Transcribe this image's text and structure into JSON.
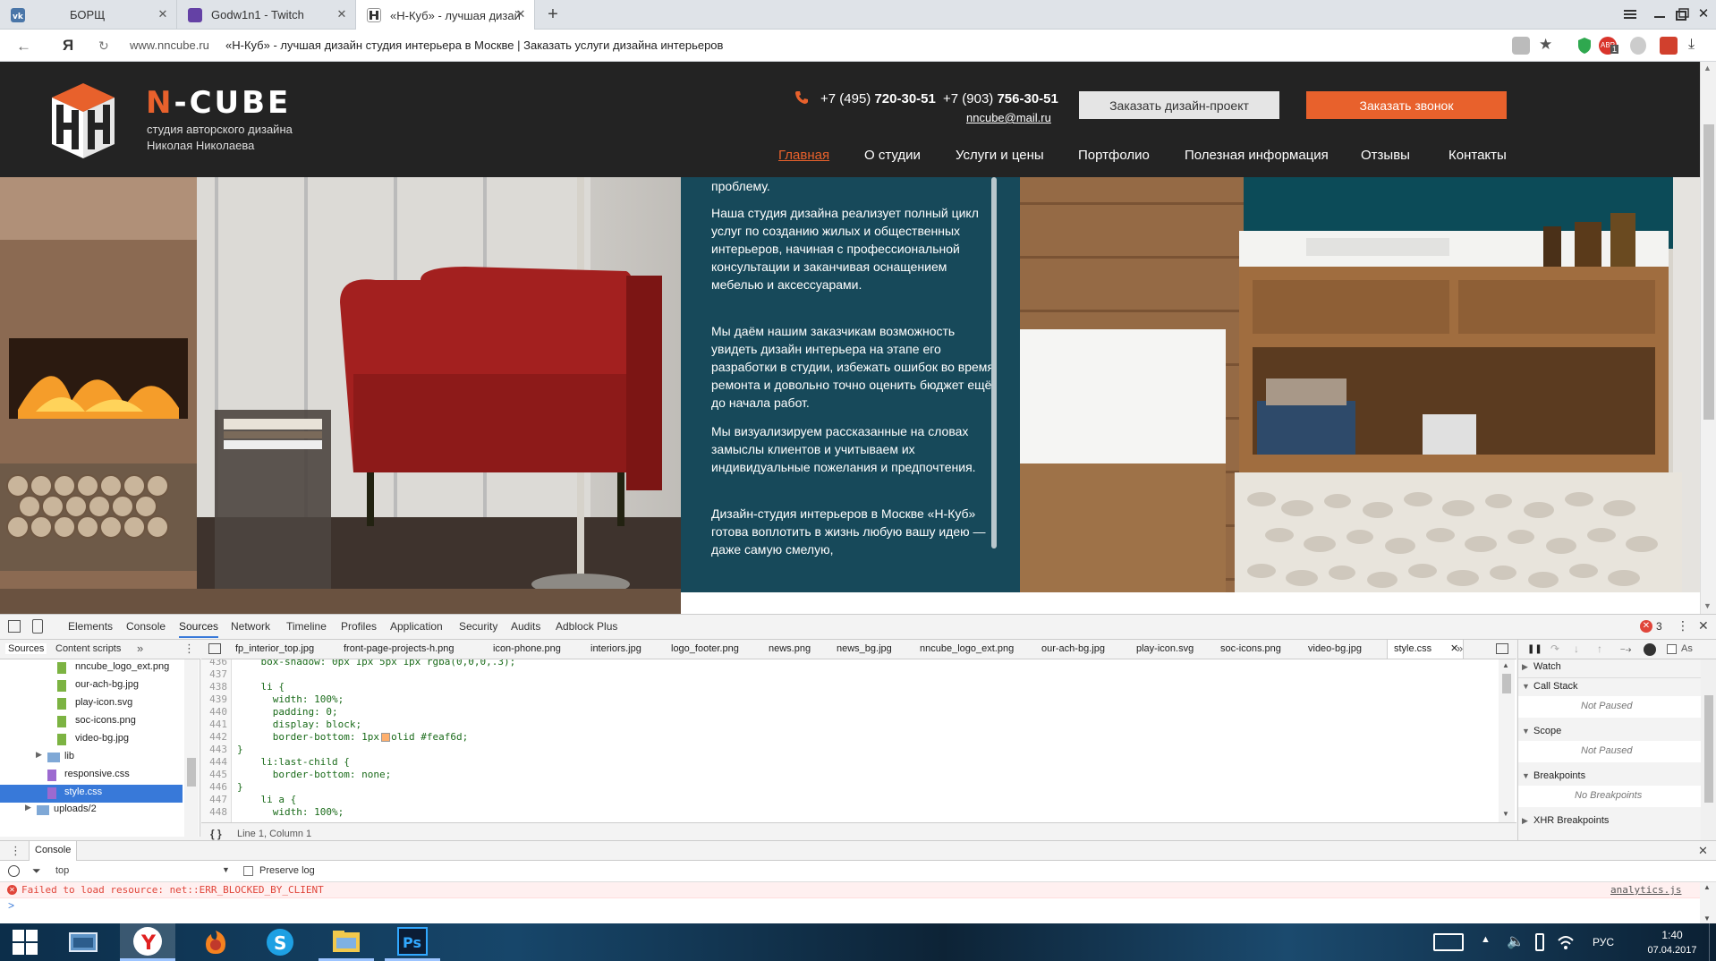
{
  "browser": {
    "tabs": [
      {
        "title": "БОРЩ"
      },
      {
        "title": "Godw1n1 - Twitch"
      },
      {
        "title": "«Н-Куб» - лучшая дизай"
      }
    ],
    "new_tab": "+",
    "address": {
      "domain": "www.nncube.ru",
      "page_title": "«Н-Куб» - лучшая дизайн студия интерьера в Москве | Заказать услуги дизайна интерьеров",
      "yandex_logo": "Я"
    },
    "menu_badge": "1"
  },
  "site": {
    "logo_text": "N-CUBE",
    "logo_sub1": "студия авторского дизайна",
    "logo_sub2": "Николая Николаева",
    "phone1_prefix": "+7 (495)",
    "phone1_number": "720-30-51",
    "phone2_prefix": "+7 (903)",
    "phone2_number": "756-30-51",
    "email": "nncube@mail.ru",
    "btn_design": "Заказать дизайн-проект",
    "btn_call": "Заказать звонок",
    "nav": [
      "Главная",
      "О студии",
      "Услуги и цены",
      "Портфолио",
      "Полезная информация",
      "Отзывы",
      "Контакты"
    ],
    "text_fragment": "проблему.",
    "paragraphs": [
      "Наша студия дизайна реализует полный цикл услуг по созданию жилых и общественных интерьеров, начиная с профессиональной консультации и заканчивая оснащением мебелью и аксессуарами.",
      "Мы даём нашим заказчикам возможность увидеть дизайн интерьера на этапе его разработки в студии, избежать ошибок во время ремонта и довольно точно оценить бюджет ещё до начала работ.",
      "Мы визуализируем рассказанные на словах замыслы клиентов и учитываем их индивидуальные пожелания и предпочтения.",
      "Дизайн-студия интерьеров в Москве «Н-Куб» готова воплотить в жизнь любую вашу идею — даже самую смелую,"
    ],
    "accent": "#e8612c",
    "panel_color": "#17495a"
  },
  "devtools": {
    "tabs": [
      "Elements",
      "Console",
      "Sources",
      "Network",
      "Timeline",
      "Profiles",
      "Application",
      "Security",
      "Audits",
      "Adblock Plus"
    ],
    "active_tab": "Sources",
    "error_count": "3",
    "left_tabs": [
      "Sources",
      "Content scripts"
    ],
    "file_tabs": [
      "fp_interior_top.jpg",
      "front-page-projects-h.png",
      "icon-phone.png",
      "interiors.jpg",
      "logo_footer.png",
      "news.png",
      "news_bg.jpg",
      "nncube_logo_ext.png",
      "our-ach-bg.jpg",
      "play-icon.svg",
      "soc-icons.png",
      "video-bg.jpg",
      "style.css"
    ],
    "tree": [
      {
        "name": "nncube_logo_ext.png",
        "type": "file"
      },
      {
        "name": "our-ach-bg.jpg",
        "type": "file"
      },
      {
        "name": "play-icon.svg",
        "type": "file"
      },
      {
        "name": "soc-icons.png",
        "type": "file"
      },
      {
        "name": "video-bg.jpg",
        "type": "file"
      },
      {
        "name": "lib",
        "type": "folder"
      },
      {
        "name": "responsive.css",
        "type": "css"
      },
      {
        "name": "style.css",
        "type": "css-selected"
      },
      {
        "name": "uploads/2",
        "type": "folder"
      }
    ],
    "code_lines": [
      {
        "n": "436",
        "t": "    box-shadow: 0px 1px 5px 1px rgba(0,0,0,.3);"
      },
      {
        "n": "437",
        "t": ""
      },
      {
        "n": "438",
        "t": "    li {"
      },
      {
        "n": "439",
        "t": "      width: 100%;"
      },
      {
        "n": "440",
        "t": "      padding: 0;"
      },
      {
        "n": "441",
        "t": "      display: block;"
      },
      {
        "n": "442",
        "t": "      border-bottom: 1px solid #feaf6d;"
      },
      {
        "n": "443",
        "t": "}"
      },
      {
        "n": "444",
        "t": "    li:last-child {"
      },
      {
        "n": "445",
        "t": "      border-bottom: none;"
      },
      {
        "n": "446",
        "t": "}"
      },
      {
        "n": "447",
        "t": "    li a {"
      },
      {
        "n": "448",
        "t": "      width: 100%;"
      }
    ],
    "status": "Line 1, Column 1",
    "right_panel": {
      "watch": "Watch",
      "call_stack": "Call Stack",
      "not_paused": "Not Paused",
      "scope": "Scope",
      "not_paused2": "Not Paused",
      "breakpoints": "Breakpoints",
      "no_breakpoints": "No Breakpoints",
      "xhr": "XHR Breakpoints",
      "async": "As"
    },
    "console": {
      "title": "Console",
      "context": "top",
      "preserve_log": "Preserve log",
      "error_text": "Failed to load resource: net::ERR_BLOCKED_BY_CLIENT",
      "error_source": "analytics.js",
      "prompt": ">"
    }
  },
  "taskbar": {
    "lang": "РУС",
    "time": "1:40",
    "date": "07.04.2017",
    "apps": [
      "yandex-browser",
      "firefox",
      "skype",
      "file-explorer",
      "photoshop"
    ]
  }
}
